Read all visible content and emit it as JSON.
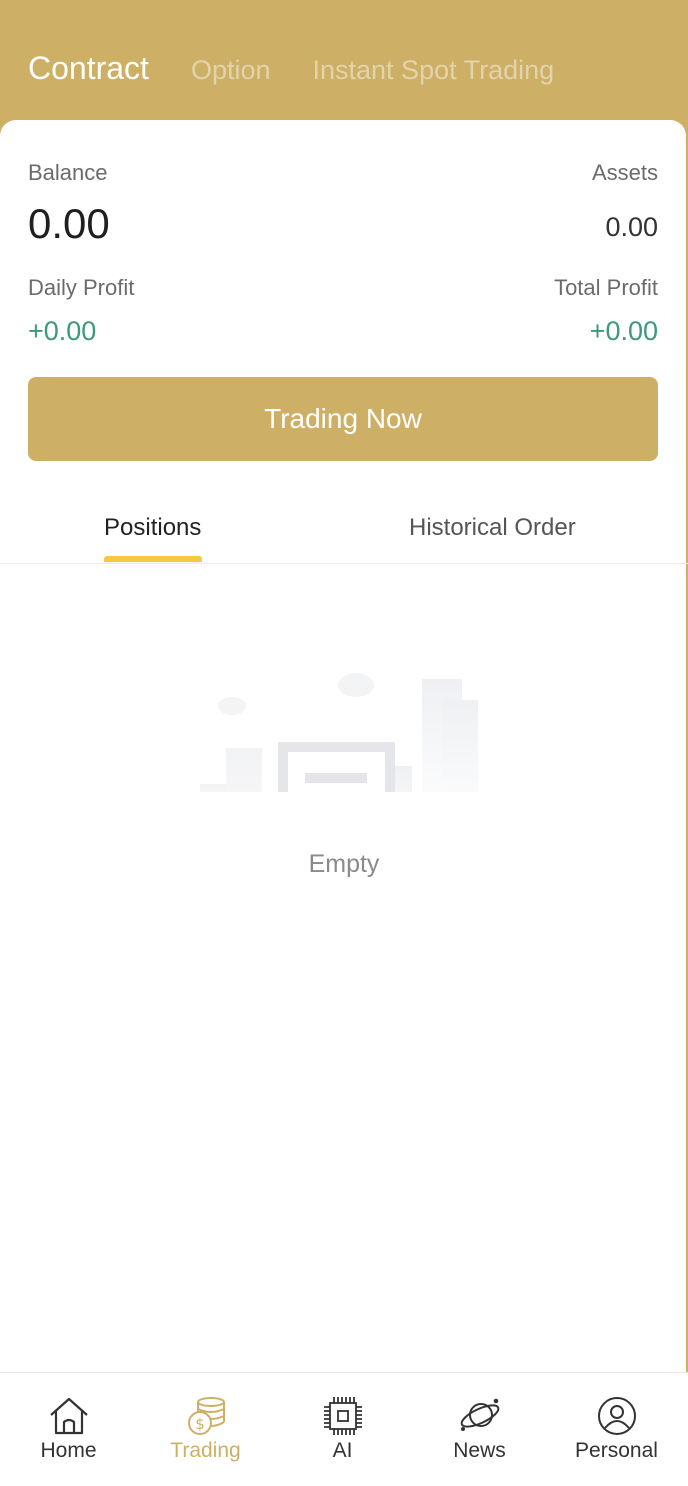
{
  "header": {
    "tabs": [
      {
        "label": "Contract",
        "active": true
      },
      {
        "label": "Option",
        "active": false
      },
      {
        "label": "Instant Spot Trading",
        "active": false
      }
    ]
  },
  "account": {
    "balance_label": "Balance",
    "balance_value": "0.00",
    "assets_label": "Assets",
    "assets_value": "0.00",
    "daily_profit_label": "Daily Profit",
    "daily_profit_value": "+0.00",
    "total_profit_label": "Total Profit",
    "total_profit_value": "+0.00"
  },
  "trade_button_label": "Trading Now",
  "sub_tabs": {
    "positions": "Positions",
    "history": "Historical Order",
    "active": "positions"
  },
  "empty_state": {
    "text": "Empty",
    "icon": "empty-document-icon"
  },
  "bottom_nav": [
    {
      "label": "Home",
      "icon": "home-icon",
      "active": false
    },
    {
      "label": "Trading",
      "icon": "coins-icon",
      "active": true
    },
    {
      "label": "AI",
      "icon": "chip-icon",
      "active": false
    },
    {
      "label": "News",
      "icon": "planet-icon",
      "active": false
    },
    {
      "label": "Personal",
      "icon": "user-icon",
      "active": false
    }
  ],
  "colors": {
    "brand": "#cdb066",
    "profit": "#3c9a78",
    "tab_indicator": "#f2cb43"
  }
}
